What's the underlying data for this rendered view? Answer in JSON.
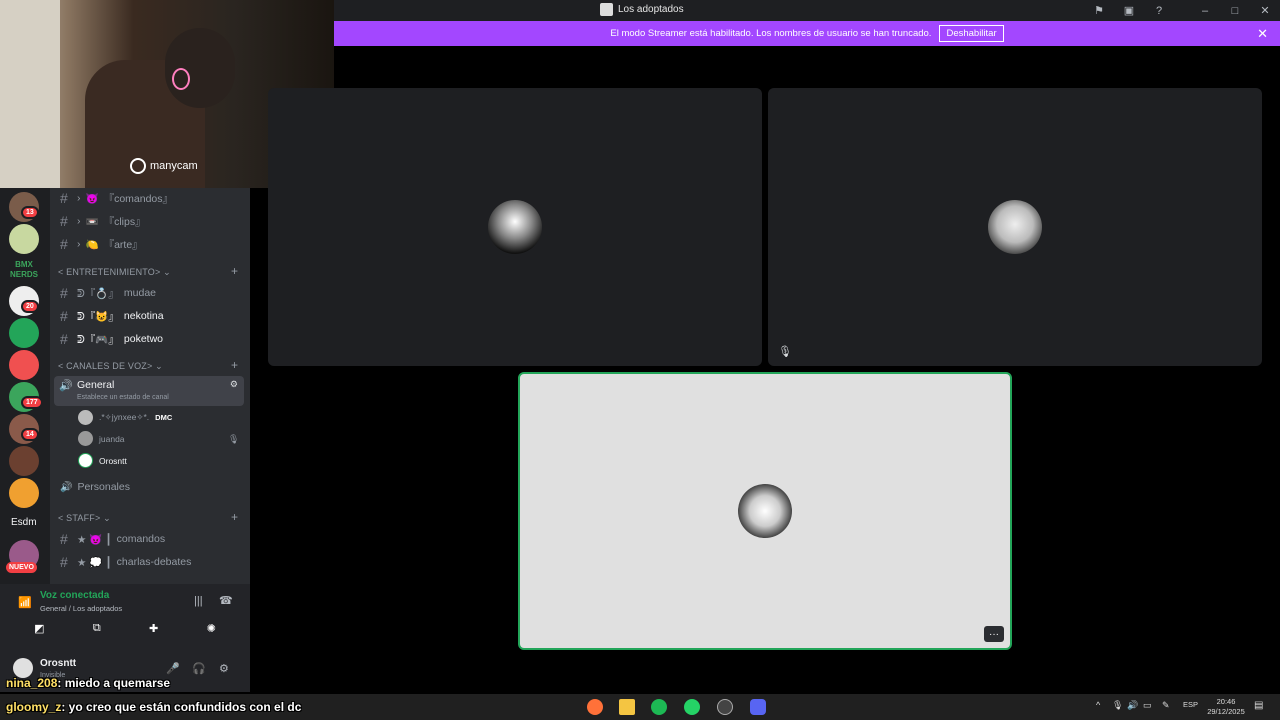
{
  "window": {
    "title": "Los adoptados"
  },
  "banner": {
    "text": "El modo Streamer está habilitado. Los nombres de usuario se han truncado.",
    "button": "Deshabilitar"
  },
  "webcam": {
    "watermark": "manycam"
  },
  "servers": {
    "badges": [
      "13",
      "20",
      "177",
      "14"
    ],
    "labels": {
      "esdm": "Esdm",
      "nuevo": "NUEVO",
      "bmx": "BMX NERDS"
    }
  },
  "channels": {
    "top": [
      {
        "prefix": "›",
        "emoji": "😈",
        "name": "『comandos』"
      },
      {
        "prefix": "›",
        "emoji": "📼",
        "name": "『clips』"
      },
      {
        "prefix": "›",
        "emoji": "🍋",
        "name": "『arte』"
      }
    ],
    "cat_entertainment": "ENTRETENIMIENTO",
    "entertainment": [
      {
        "prefix": "ᕲ『💍』",
        "name": "mudae"
      },
      {
        "prefix": "ᕲ『😺』",
        "name": "nekotina"
      },
      {
        "prefix": "ᕲ『🎮』",
        "name": "poketwo"
      }
    ],
    "cat_voice": "CANALES DE VOZ",
    "voice_channel": "General",
    "voice_status": "Establece un estado de canal",
    "voice_users": [
      {
        "name": ".*✧jynxee✧*.",
        "tag": "DMC"
      },
      {
        "name": "juanda",
        "tag": ""
      },
      {
        "name": "Orosntt",
        "tag": ""
      }
    ],
    "personales": "Personales",
    "cat_staff": "STAFF",
    "staff": [
      {
        "prefix": "★ 😈 ┃",
        "name": "comandos"
      },
      {
        "prefix": "★ 💭 ┃",
        "name": "charlas-debates"
      }
    ]
  },
  "voice": {
    "status": "Voz conectada",
    "location": "General / Los adoptados"
  },
  "user": {
    "name": "Orosntt",
    "status": "Invisible"
  },
  "chat": [
    {
      "user": "nina_208",
      "text": ": miedo a quemarse"
    },
    {
      "user": "gloomy_z",
      "text": ": yo creo que están confundidos con el dc"
    }
  ],
  "taskbar": {
    "lang": "ESP",
    "time": "20:46",
    "date": "29/12/2025"
  },
  "colors": {
    "accent": "#a347ff",
    "speaking": "#23a559",
    "tile_dark": "#1e1f22",
    "tile_light": "#e0e0e0"
  },
  "icons": {
    "close": "close-icon",
    "settings": "gear-icon",
    "mic": "mic-icon",
    "headphones": "headphones-icon"
  }
}
